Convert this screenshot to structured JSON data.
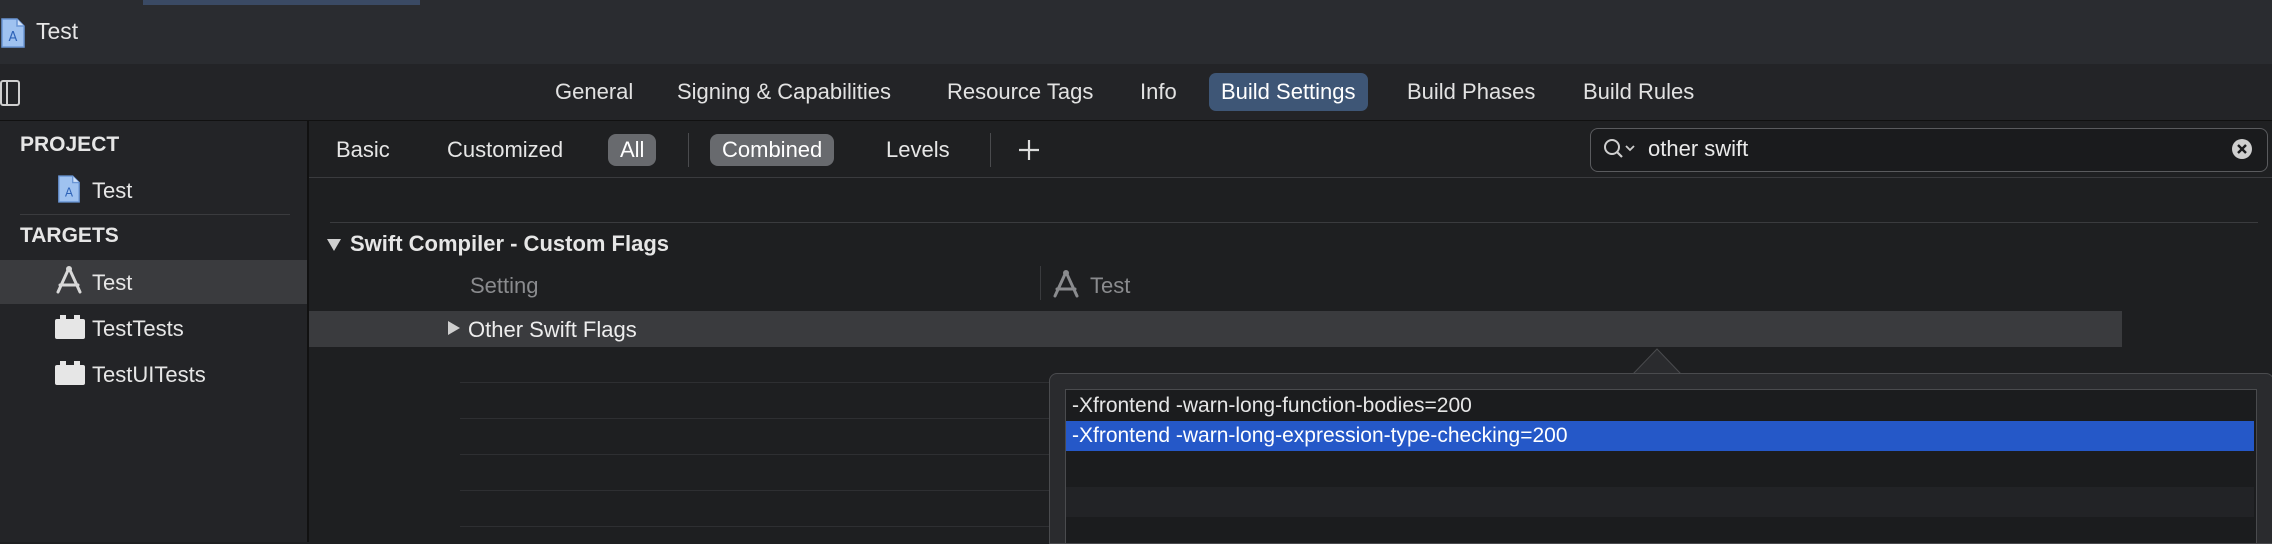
{
  "window": {
    "title": "Test"
  },
  "tabs": [
    {
      "label": "General"
    },
    {
      "label": "Signing & Capabilities"
    },
    {
      "label": "Resource Tags"
    },
    {
      "label": "Info"
    },
    {
      "label": "Build Settings",
      "selected": true
    },
    {
      "label": "Build Phases"
    },
    {
      "label": "Build Rules"
    }
  ],
  "sidebar": {
    "project_header": "PROJECT",
    "project_items": [
      {
        "label": "Test",
        "icon": "xcode-project-icon"
      }
    ],
    "targets_header": "TARGETS",
    "target_items": [
      {
        "label": "Test",
        "icon": "app-target-icon",
        "selected": true
      },
      {
        "label": "TestTests",
        "icon": "test-bundle-icon"
      },
      {
        "label": "TestUITests",
        "icon": "test-bundle-icon"
      }
    ]
  },
  "filters": {
    "basic": "Basic",
    "customized": "Customized",
    "all": "All",
    "combined": "Combined",
    "levels": "Levels",
    "add_icon": "plus-icon"
  },
  "search": {
    "value": "other swift",
    "icon": "search-icon",
    "clear_icon": "clear-icon"
  },
  "settings": {
    "group_title": "Swift Compiler - Custom Flags",
    "column_setting": "Setting",
    "column_target": "Test",
    "rows": [
      {
        "name": "Other Swift Flags"
      }
    ]
  },
  "popover": {
    "lines": [
      "-Xfrontend -warn-long-function-bodies=200",
      "-Xfrontend -warn-long-expression-type-checking=200"
    ],
    "selected_index": 1
  },
  "colors": {
    "selected_tab": "#3e5676",
    "selection_blue": "#2558c8",
    "background": "#1e1f21"
  }
}
